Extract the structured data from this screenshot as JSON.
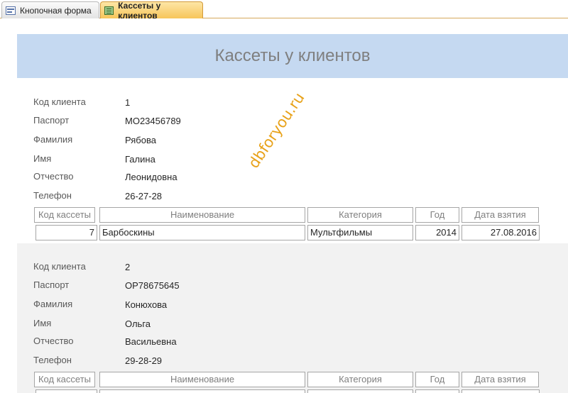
{
  "tabs": [
    {
      "label": "Кнопочная форма",
      "icon": "form-icon",
      "active": false
    },
    {
      "label": "Кассеты у клиентов",
      "icon": "report-icon",
      "active": true
    }
  ],
  "report": {
    "title": "Кассеты у клиентов",
    "field_labels": {
      "client_id": "Код клиента",
      "passport": "Паспорт",
      "surname": "Фамилия",
      "name": "Имя",
      "patronymic": "Отчество",
      "phone": "Телефон"
    },
    "table_headers": [
      "Код кассеты",
      "Наименование",
      "Категория",
      "Год",
      "Дата взятия"
    ],
    "clients": [
      {
        "client_id": "1",
        "passport": "МО23456789",
        "surname": "Рябова",
        "name": "Галина",
        "patronymic": "Леонидовна",
        "phone": "26-27-28",
        "rows": [
          {
            "cassette_id": "7",
            "title": "Барбоскины",
            "category": "Мультфильмы",
            "year": "2014",
            "date": "27.08.2016"
          }
        ]
      },
      {
        "client_id": "2",
        "passport": "ОР78675645",
        "surname": "Конюхова",
        "name": "Ольга",
        "patronymic": "Васильевна",
        "phone": "29-28-29",
        "rows": []
      }
    ]
  },
  "watermark": "dbforyou.ru",
  "colors": {
    "header_band": "#c5d9f1",
    "alt_group": "#f2f2f2",
    "active_tab": "#f7c55a",
    "watermark": "#e8a21a"
  }
}
